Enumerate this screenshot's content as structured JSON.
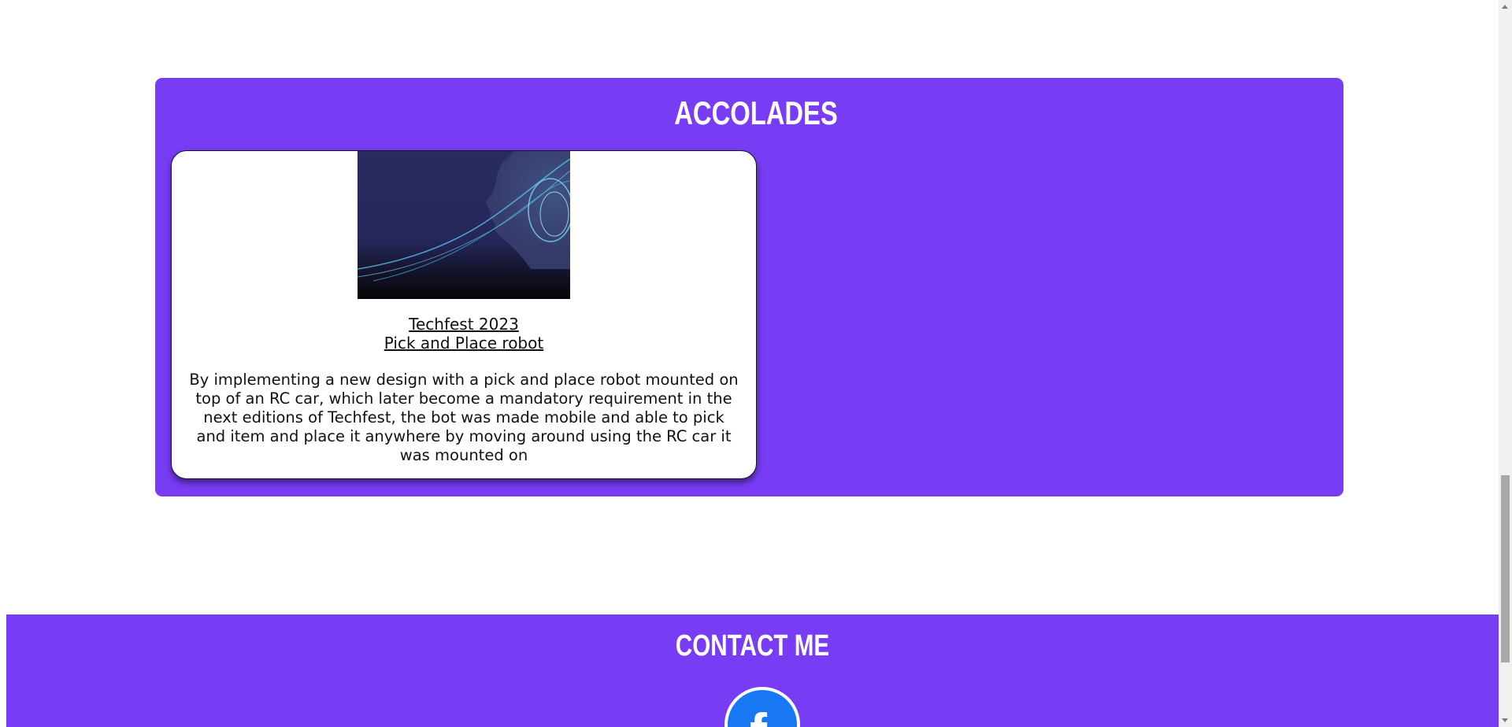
{
  "accolades": {
    "title": "ACCOLADES",
    "cards": [
      {
        "title_line1": "Techfest 2023",
        "title_line2": "Pick and Place robot",
        "description": "By implementing a new design with a pick and place robot mounted on top of an RC car, which later become a mandatory requirement in the next editions of Techfest, the bot was made mobile and able to pick and item and place it anywhere by moving around using the RC car it was mounted on"
      }
    ]
  },
  "contact": {
    "title": "CONTACT ME",
    "social": [
      {
        "icon": "facebook-icon",
        "label": "f"
      }
    ]
  },
  "colors": {
    "accent": "#783cf5",
    "card_bg": "#ffffff",
    "facebook": "#1877f2"
  }
}
